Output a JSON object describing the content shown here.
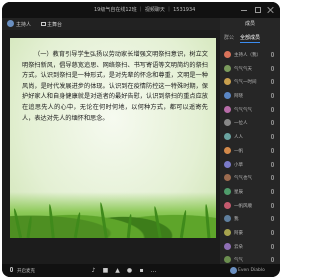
{
  "window": {
    "title": "19级气自在线12班 ｜ 视频聊天 ｜ 1531934"
  },
  "top": {
    "host": "主持人",
    "stage": "主舞台"
  },
  "slide": {
    "text": "（一）教育引导学生弘扬以劳动家长增强文明祭扫意识，树立文明祭扫新风，倡导慈宽追思、网络祭扫、书写寄语等文明简约的祭扫方式，认识到祭扫是一种形式，是对先辈的怀念和尊重，文明是一种风尚，是时代发展进步的体现。认识到在疫情防控这一特殊时期，保护好家人和自身健康就是对逝者的最好告慰，认识到祭扫的重点应放在追思先人的心中，无论在何时何地，以何种方式，都可以遥寄先人，表达对先人的缅怀和思念。"
  },
  "panel": {
    "header": "成员",
    "tabs": [
      "群公",
      "全部成员"
    ],
    "members": [
      "主持人（我）",
      "气气气天",
      "气气一时间",
      "阿晓",
      "气气气气",
      "一位人",
      "人人",
      "一帆",
      "小草",
      "气气也气",
      "星辰",
      "一帆风顺",
      "我",
      "阿豪",
      "云朵",
      "气气",
      "一笑"
    ]
  },
  "toolbar": {
    "mic_label": "开启麦克",
    "user": "Even Diablo"
  }
}
